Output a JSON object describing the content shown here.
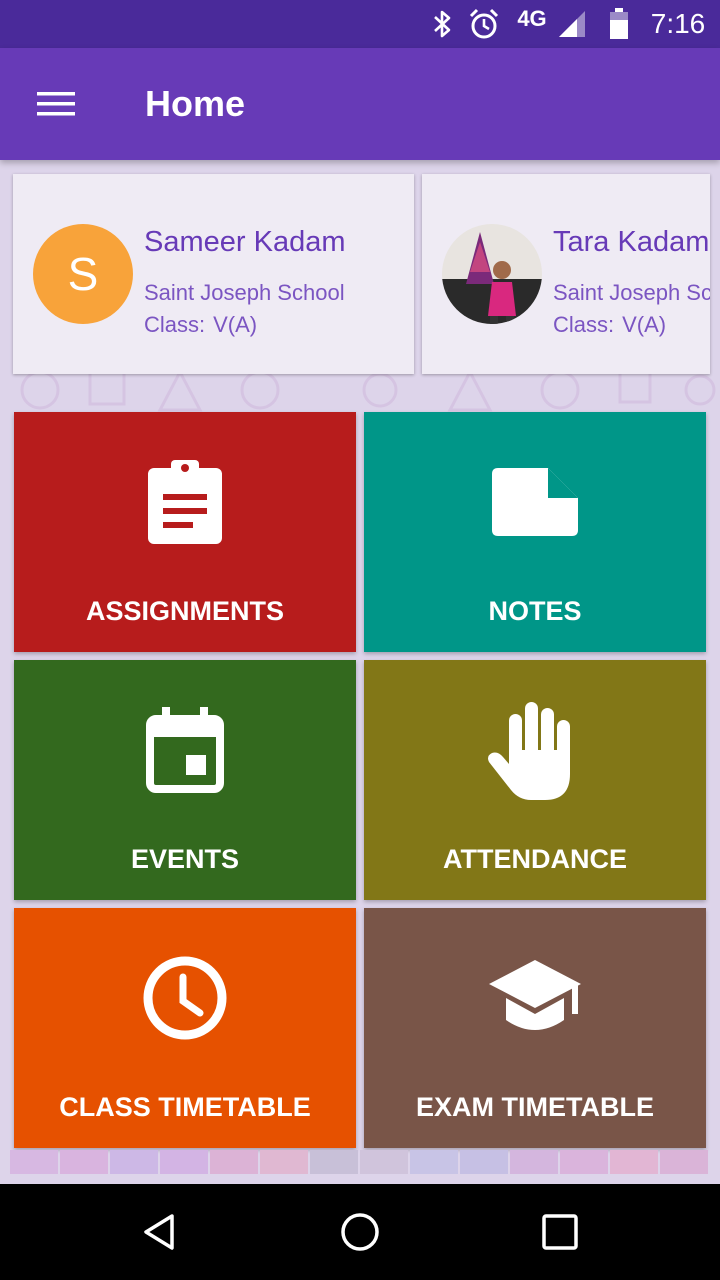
{
  "status_bar": {
    "icons": [
      "bluetooth-icon",
      "alarm-icon",
      "signal-icon",
      "battery-icon"
    ],
    "network": "4G",
    "time": "7:16"
  },
  "app_bar": {
    "menu_icon": "hamburger-menu-icon",
    "title": "Home"
  },
  "students": [
    {
      "initial": "S",
      "name": "Sameer Kadam",
      "school": "Saint Joseph School",
      "class_label": "Class:",
      "class_value": "V(A)",
      "avatar_color": "#f8a33a"
    },
    {
      "initial": "",
      "name": "Tara Kadam",
      "school": "Saint Joseph School",
      "class_label": "Class:",
      "class_value": "V(A)"
    }
  ],
  "tiles": [
    {
      "label": "ASSIGNMENTS",
      "icon": "clipboard-icon",
      "color": "#b71c1c"
    },
    {
      "label": "NOTES",
      "icon": "note-icon",
      "color": "#009688"
    },
    {
      "label": "EVENTS",
      "icon": "calendar-event-icon",
      "color": "#33691e"
    },
    {
      "label": "ATTENDANCE",
      "icon": "raised-hand-icon",
      "color": "#827717"
    },
    {
      "label": "CLASS TIMETABLE",
      "icon": "clock-icon",
      "color": "#e65100"
    },
    {
      "label": "EXAM TIMETABLE",
      "icon": "graduation-cap-icon",
      "color": "#795548"
    }
  ],
  "nav_bar": {
    "buttons": [
      "back-icon",
      "home-icon",
      "recents-icon"
    ]
  },
  "colors": {
    "status_bar": "#4a2a9a",
    "app_bar": "#673ab7",
    "background": "#ddd4ea",
    "card": "#efebf4",
    "accent_text": "#673ab7"
  }
}
